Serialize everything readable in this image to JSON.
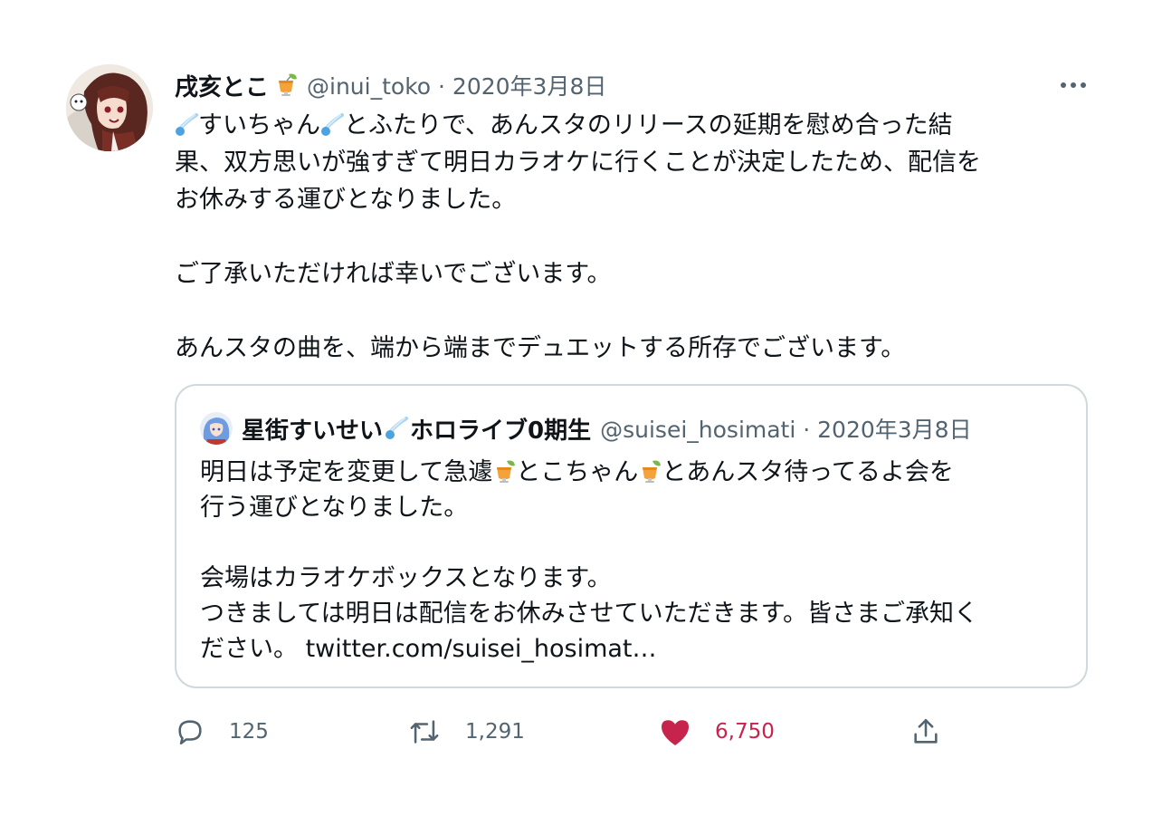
{
  "tweet": {
    "author": {
      "display_name": "戌亥とこ",
      "name_emoji": "cocktail-emoji",
      "handle_meta": "@inui_toko · 2020年3月8日"
    },
    "more_icon": "more-icon",
    "paragraphs": [
      "すいちゃん",
      "とふたりで、あんスタのリリースの延期を慰め合った結果、双方思いが強すぎて明日カラオケに行くことが決定したため、配信をお休みする運び となりました。",
      "ご了承いただければ幸いでございます。",
      "あんスタの曲を、端から端までデュエットする所存でございます。"
    ],
    "line1_tail": "とふたりで、あんスタのリリースの延期を慰め合った結",
    "line2": "果、双方思いが強すぎて明日カラオケに行くことが決定したため、配信を",
    "line3": "お休みする運びとなりました。",
    "line4": "ご了承いただければ幸いでございます。",
    "line5": "あんスタの曲を、端から端までデュエットする所存でございます。",
    "quote": {
      "display_name": "星街すいせい",
      "name_suffix": "ホロライブ0期生",
      "handle_meta": "@suisei_hosimati · 2020年3月8日",
      "line1_a": "明日は予定を変更して急遽",
      "line1_b": "とこちゃん",
      "line1_c": "とあんスタ待ってるよ会を",
      "line2": "行う運びとなりました。",
      "line3": "会場はカラオケボックスとなります。",
      "line4": "つきましては明日は配信をお休みさせていただきます。皆さまご承知く",
      "line5_text": "ださい。",
      "line5_link": "twitter.com/suisei_hosimat…"
    },
    "actions": {
      "reply_count": "125",
      "retweet_count": "1,291",
      "like_count": "6,750",
      "like_color": "#c7244d"
    },
    "colors": {
      "text": "#0f1419",
      "secondary": "#536471",
      "border": "#cfd9de",
      "like": "#c7244d"
    }
  }
}
